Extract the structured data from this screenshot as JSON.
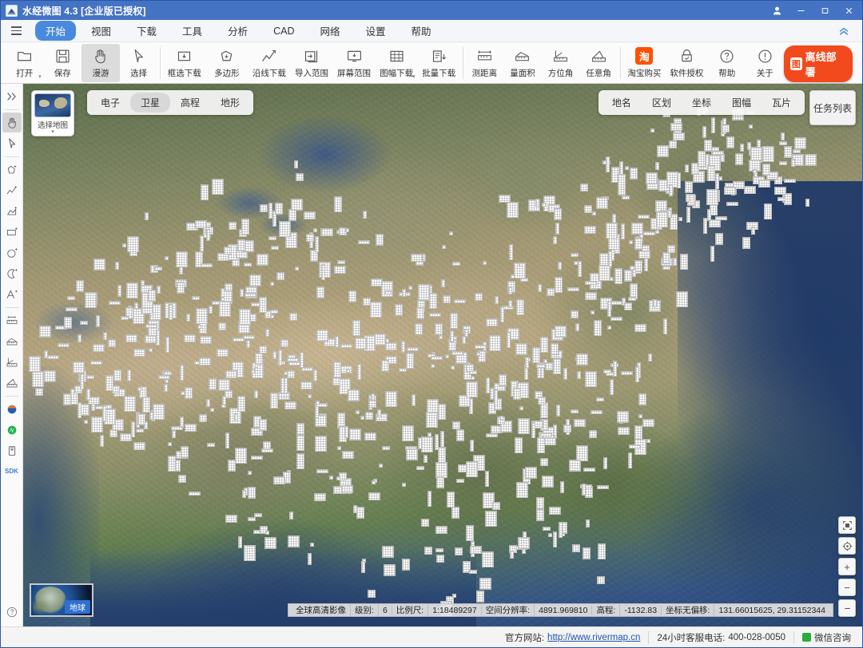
{
  "titlebar": {
    "title": "水经微图 4.3 [企业版已授权]",
    "logo_icon": "app-logo-icon",
    "account_icon": "user-account-icon",
    "minimize_icon": "minimize-icon",
    "maximize_icon": "maximize-icon",
    "close_icon": "close-icon",
    "bg_color": "#4573c4"
  },
  "menubar": {
    "hamburger_icon": "hamburger-menu-icon",
    "collapse_icon": "chevron-double-up-icon",
    "items": [
      {
        "label": "开始",
        "active": true
      },
      {
        "label": "视图",
        "active": false
      },
      {
        "label": "下载",
        "active": false
      },
      {
        "label": "工具",
        "active": false
      },
      {
        "label": "分析",
        "active": false
      },
      {
        "label": "CAD",
        "active": false
      },
      {
        "label": "网络",
        "active": false
      },
      {
        "label": "设置",
        "active": false
      },
      {
        "label": "帮助",
        "active": false
      }
    ]
  },
  "ribbon": {
    "tools": [
      {
        "label": "打开",
        "icon": "folder-open-icon",
        "active": false,
        "dropdown": true
      },
      {
        "label": "保存",
        "icon": "save-disk-icon",
        "active": false,
        "dropdown": false
      },
      {
        "label": "漫游",
        "icon": "hand-pan-icon",
        "active": true,
        "dropdown": false
      },
      {
        "label": "选择",
        "icon": "cursor-arrow-icon",
        "active": false,
        "dropdown": false
      },
      {
        "label": "框选下载",
        "icon": "rectangle-select-download-icon",
        "active": false,
        "dropdown": false
      },
      {
        "label": "多边形",
        "icon": "polygon-select-icon",
        "active": false,
        "dropdown": false
      },
      {
        "label": "沿线下载",
        "icon": "polyline-download-icon",
        "active": false,
        "dropdown": false
      },
      {
        "label": "导入范围",
        "icon": "import-range-icon",
        "active": false,
        "dropdown": false
      },
      {
        "label": "屏幕范围",
        "icon": "screen-range-icon",
        "active": false,
        "dropdown": false
      },
      {
        "label": "图幅下载",
        "icon": "map-sheet-download-icon",
        "active": false,
        "dropdown": true
      },
      {
        "label": "批量下载",
        "icon": "batch-download-icon",
        "active": false,
        "dropdown": false
      },
      {
        "label": "测距离",
        "icon": "measure-distance-icon",
        "active": false,
        "dropdown": false
      },
      {
        "label": "量面积",
        "icon": "measure-area-icon",
        "active": false,
        "dropdown": false
      },
      {
        "label": "方位角",
        "icon": "azimuth-angle-icon",
        "active": false,
        "dropdown": false
      },
      {
        "label": "任意角",
        "icon": "arbitrary-angle-icon",
        "active": false,
        "dropdown": false
      },
      {
        "label": "淘宝购买",
        "icon": "taobao-buy-icon",
        "active": false,
        "dropdown": false
      },
      {
        "label": "软件授权",
        "icon": "license-lock-icon",
        "active": false,
        "dropdown": false
      },
      {
        "label": "帮助",
        "icon": "help-question-icon",
        "active": false,
        "dropdown": false
      },
      {
        "label": "关于",
        "icon": "about-info-icon",
        "active": false,
        "dropdown": false
      }
    ],
    "promo": {
      "label": "离线部署",
      "badge": "图",
      "color": "#f24a1c"
    }
  },
  "sidebar": {
    "items": [
      {
        "icon": "expand-panel-icon",
        "active": false
      },
      {
        "icon": "hand-pan-icon",
        "active": true
      },
      {
        "icon": "cursor-arrow-icon",
        "active": false
      },
      {
        "icon": "add-polygon-icon",
        "active": false
      },
      {
        "icon": "add-polyline-icon",
        "active": false
      },
      {
        "icon": "add-shape-icon",
        "active": false
      },
      {
        "icon": "add-rectangle-icon",
        "active": false
      },
      {
        "icon": "add-circle-icon",
        "active": false
      },
      {
        "icon": "add-arc-icon",
        "active": false
      },
      {
        "icon": "add-text-icon",
        "active": false
      },
      {
        "icon": "measure-distance-icon",
        "active": false
      },
      {
        "icon": "measure-area-icon",
        "active": false
      },
      {
        "icon": "measure-height-icon",
        "active": false
      },
      {
        "icon": "measure-slope-icon",
        "active": false
      },
      {
        "icon": "earth-layer-icon",
        "active": false
      },
      {
        "icon": "track-record-icon",
        "active": false
      },
      {
        "icon": "bookmark-panel-icon",
        "active": false
      }
    ],
    "sdk_label": "SDK",
    "help_icon": "help-circle-icon"
  },
  "map": {
    "layer_picker": {
      "label": "选择地图",
      "icon": "map-thumbnail-icon",
      "caret_icon": "chevron-down-icon"
    },
    "basemap_tabs": [
      {
        "label": "电子",
        "active": false
      },
      {
        "label": "卫星",
        "active": true
      },
      {
        "label": "高程",
        "active": false
      },
      {
        "label": "地形",
        "active": false
      }
    ],
    "overlay_tabs": [
      {
        "label": "地名",
        "active": false
      },
      {
        "label": "区划",
        "active": false
      },
      {
        "label": "坐标",
        "active": false
      },
      {
        "label": "图幅",
        "active": false
      },
      {
        "label": "瓦片",
        "active": false
      }
    ],
    "task_list_button": "任务列表",
    "controls": [
      {
        "icon": "fit-extent-icon"
      },
      {
        "icon": "locate-target-icon"
      },
      {
        "icon": "zoom-in-icon",
        "glyph": "+"
      },
      {
        "icon": "zoom-out-icon",
        "glyph": "−"
      }
    ],
    "globe_widget": {
      "label": "地球",
      "icon": "globe-thumbnail-icon"
    }
  },
  "statusbar": {
    "source": "全球高清影像",
    "level_label": "级别:",
    "level_value": "6",
    "scale_label": "比例尺:",
    "scale_value": "1:18489297",
    "resolution_label": "空间分辨率:",
    "resolution_value": "4891.969810",
    "elevation_label": "高程:",
    "elevation_value": "-1132.83",
    "coord_label": "坐标无偏移:",
    "coord_value": "131.66015625, 29.31152344",
    "collapse_icon": "minimize-statusbar-icon"
  },
  "footer": {
    "site_label": "官方网站:",
    "site_url": "http://www.rivermap.cn",
    "phone_label": "24小时客服电话:",
    "phone_value": "400-028-0050",
    "wechat_label": "微信咨询",
    "wechat_icon": "wechat-icon"
  }
}
